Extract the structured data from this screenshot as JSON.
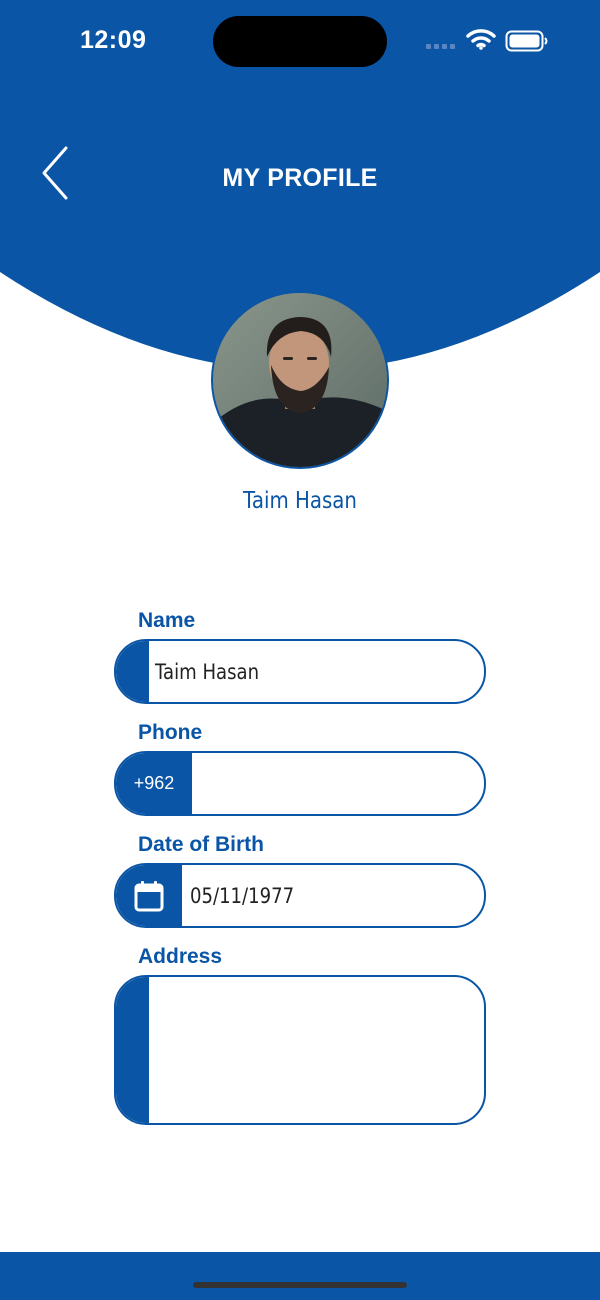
{
  "status_bar": {
    "time": "12:09"
  },
  "header": {
    "title": "MY PROFILE",
    "back_icon": "chevron-left-icon"
  },
  "profile": {
    "name": "Taim Hasan"
  },
  "form": {
    "name": {
      "label": "Name",
      "value": "Taim Hasan"
    },
    "phone": {
      "label": "Phone",
      "country_code": "+962",
      "value": ""
    },
    "dob": {
      "label": "Date of Birth",
      "value": "05/11/1977",
      "icon": "calendar-icon"
    },
    "address": {
      "label": "Address",
      "value": ""
    }
  },
  "colors": {
    "primary": "#0a55a6",
    "background": "#ffffff",
    "text": "#222222"
  }
}
